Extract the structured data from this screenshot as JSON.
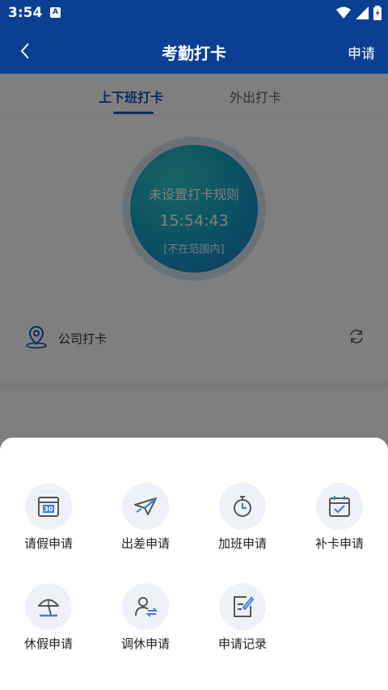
{
  "status_bar": {
    "time": "3:54",
    "notification_letter": "A"
  },
  "app_bar": {
    "title": "考勤打卡",
    "apply_label": "申请"
  },
  "tabs": [
    {
      "label": "上下班打卡",
      "active": true
    },
    {
      "label": "外出打卡",
      "active": false
    }
  ],
  "clock": {
    "rule_text": "未设置打卡规则",
    "time": "15:54:43",
    "range_text": "[不在范围内]"
  },
  "location": {
    "label": "公司打卡"
  },
  "menu": {
    "items": [
      {
        "label": "请假申请",
        "icon": "calendar-30-icon"
      },
      {
        "label": "出差申请",
        "icon": "airplane-icon"
      },
      {
        "label": "加班申请",
        "icon": "stopwatch-icon"
      },
      {
        "label": "补卡申请",
        "icon": "calendar-check-icon"
      },
      {
        "label": "休假申请",
        "icon": "beach-umbrella-icon"
      },
      {
        "label": "调休申请",
        "icon": "user-swap-icon"
      },
      {
        "label": "申请记录",
        "icon": "document-edit-icon"
      }
    ]
  },
  "colors": {
    "primary": "#0a3f94",
    "accent": "#1a56c0",
    "icon_blue": "#3f7fe0"
  }
}
